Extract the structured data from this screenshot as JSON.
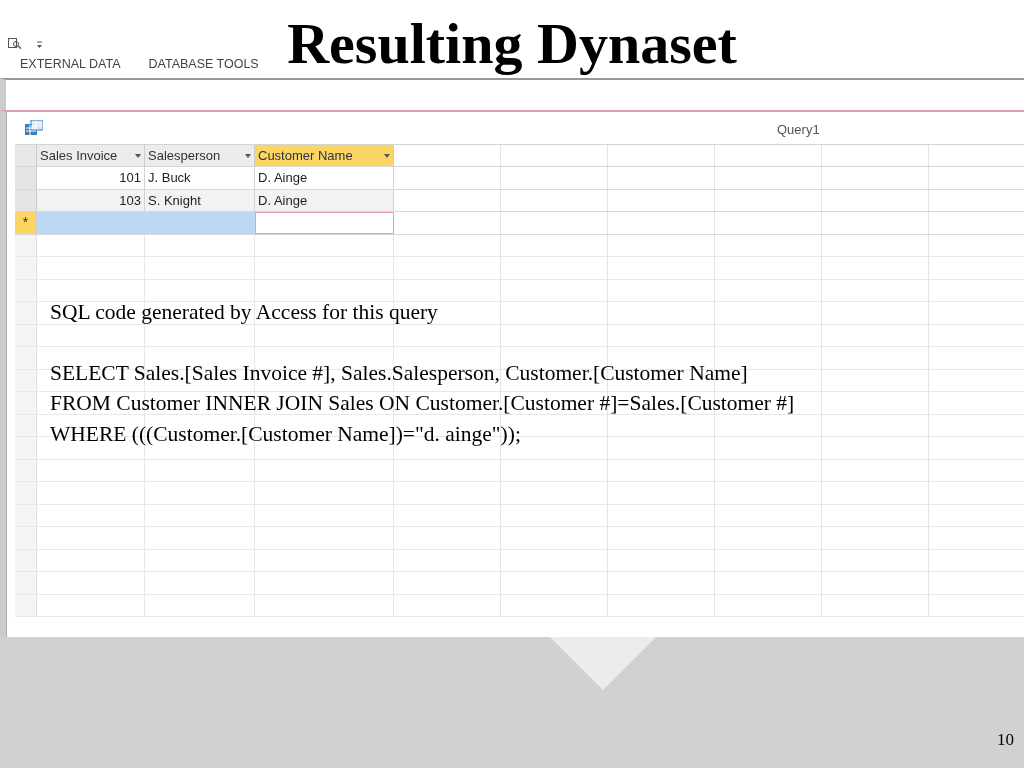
{
  "slide": {
    "title": "Resulting Dynaset",
    "page_number": "10"
  },
  "ribbon": {
    "tabs": [
      {
        "label": "EXTERNAL DATA"
      },
      {
        "label": "DATABASE TOOLS"
      }
    ]
  },
  "document_tab": {
    "title": "Query1"
  },
  "datasheet": {
    "columns": [
      {
        "label": "Sales Invoice",
        "kind": "number",
        "selected": false
      },
      {
        "label": "Salesperson",
        "kind": "text",
        "selected": false
      },
      {
        "label": "Customer Name",
        "kind": "text",
        "selected": true
      }
    ],
    "rows": [
      {
        "cells": [
          "101",
          "J. Buck",
          "D. Ainge"
        ]
      },
      {
        "cells": [
          "103",
          "S. Knight",
          "D. Ainge"
        ]
      }
    ],
    "new_row_marker": "*"
  },
  "sql_note": {
    "caption": "SQL code generated by Access for this query",
    "lines": [
      "SELECT Sales.[Sales Invoice #], Sales.Salesperson, Customer.[Customer Name]",
      "FROM Customer INNER JOIN Sales ON Customer.[Customer #]=Sales.[Customer #]",
      "WHERE (((Customer.[Customer Name])=\"d. ainge\"));"
    ]
  }
}
